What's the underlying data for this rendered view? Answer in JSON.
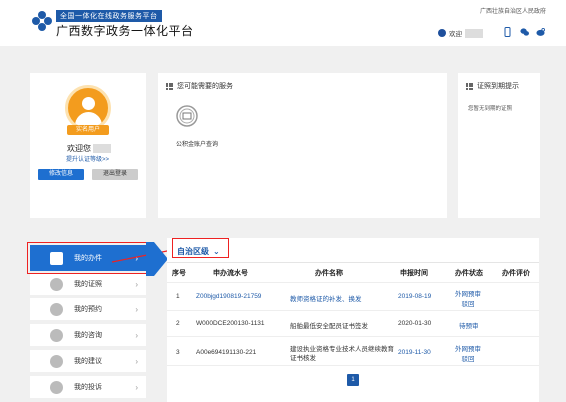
{
  "header": {
    "platform_name": "全国一体化在线政务服务平台",
    "site_title": "广西数字政务一体化平台",
    "gov_link": "广西壮族自治区人民政府",
    "welcome": "欢迎"
  },
  "profile": {
    "badge": "实名用户",
    "welcome": "欢迎您",
    "upgrade_link": "提升认证等级>>",
    "edit_button": "修改信息",
    "logout_button": "退出登录"
  },
  "services": {
    "title": "您可能需要的服务",
    "items": [
      {
        "label": "公积金账户查询",
        "icon": "fund-icon"
      }
    ]
  },
  "license_reminder": {
    "title": "证照到期提示",
    "empty_text": "您暂无到期的证照"
  },
  "sidebar": {
    "items": [
      {
        "label": "我的办件",
        "icon": "document-icon",
        "active": true
      },
      {
        "label": "我的证照",
        "icon": "license-icon"
      },
      {
        "label": "我的预约",
        "icon": "calendar-icon"
      },
      {
        "label": "我的咨询",
        "icon": "consult-icon"
      },
      {
        "label": "我的建议",
        "icon": "suggestion-icon"
      },
      {
        "label": "我的投诉",
        "icon": "complaint-icon"
      }
    ]
  },
  "main": {
    "region": "自治区级",
    "columns": [
      "序号",
      "申办流水号",
      "办件名称",
      "申报时间",
      "办件状态",
      "办件评价"
    ],
    "rows": [
      {
        "index": "1",
        "serial": "Z00bjgd190819-21759",
        "name": "教师资格证的补发、换发",
        "date": "2019-08-19",
        "status": "外网预审驳回"
      },
      {
        "index": "2",
        "serial": "W000DCE200130-1131",
        "name": "船舶最低安全配员证书签发",
        "date": "2020-01-30",
        "status": "待预审"
      },
      {
        "index": "3",
        "serial": "A00e694191130-221",
        "name_line1": "建设执业资格专业技术人员继续教育",
        "name_line2": "证书核发",
        "date": "2019-11-30",
        "status": "外网预审驳回"
      }
    ],
    "page": "1"
  },
  "colors": {
    "accent": "#1e6fd0",
    "brand": "#1e5aa8",
    "highlight": "#e22222",
    "badge": "#f39c1e"
  }
}
